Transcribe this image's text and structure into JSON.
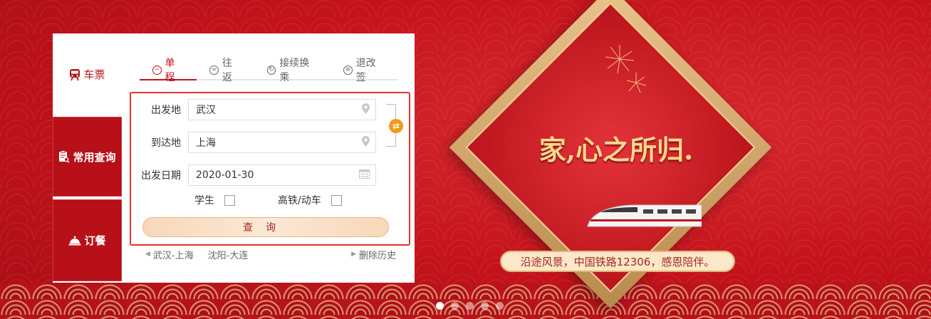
{
  "side_tabs": [
    {
      "label": "车票",
      "icon": "train-icon"
    },
    {
      "label": "常用查询",
      "icon": "clipboard-search-icon"
    },
    {
      "label": "订餐",
      "icon": "cloche-icon"
    }
  ],
  "trip_tabs": [
    {
      "label": "单程",
      "icon": "minus-circle-icon",
      "active": true
    },
    {
      "label": "往返",
      "icon": "equals-circle-icon"
    },
    {
      "label": "接续换乘",
      "icon": "transfer-circle-icon"
    },
    {
      "label": "退改签",
      "icon": "list-circle-icon"
    }
  ],
  "form": {
    "from_label": "出发地",
    "from_value": "武汉",
    "to_label": "到达地",
    "to_value": "上海",
    "date_label": "出发日期",
    "date_value": "2020-01-30",
    "student_label": "学生",
    "highspeed_label": "高铁/动车",
    "query_label": "查询"
  },
  "history": {
    "items": [
      "武汉-上海",
      "沈阳-大连"
    ],
    "clear_label": "删除历史"
  },
  "banner": {
    "headline": "家,心之所归.",
    "slogan": "沿途风景，中国铁路12306，感恩陪伴。"
  },
  "carousel": {
    "count": 5,
    "active_index": 0
  },
  "colors": {
    "brand_red": "#c0141c",
    "accent_orange": "#f49a1b",
    "gold": "#ffd78d"
  }
}
